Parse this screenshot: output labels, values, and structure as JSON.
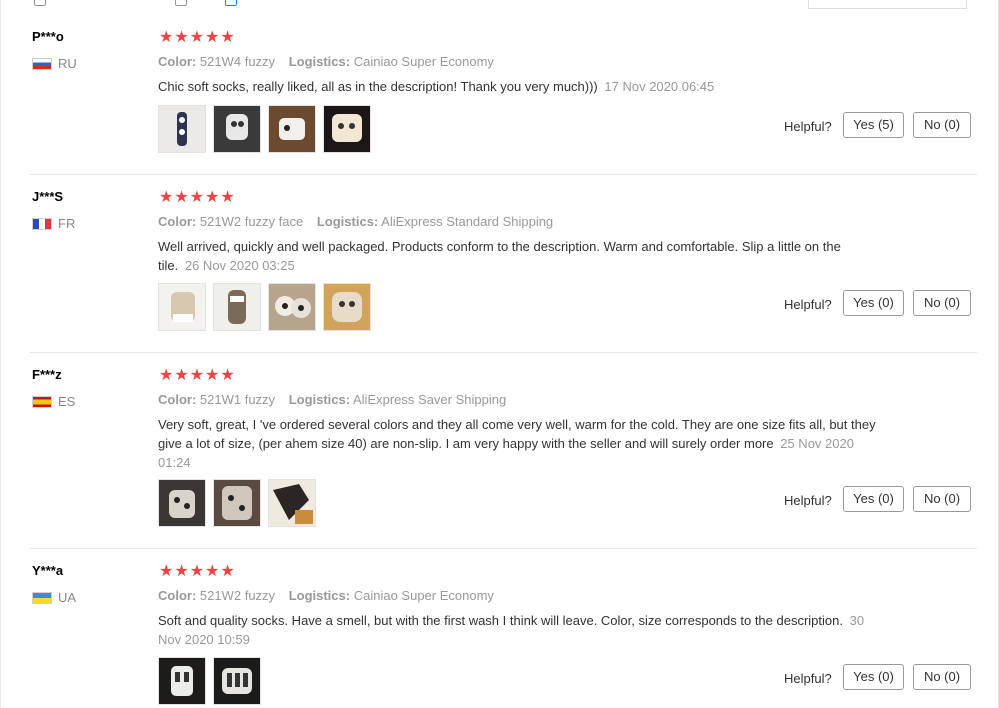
{
  "labels": {
    "color": "Color:",
    "logistics": "Logistics:",
    "helpful": "Helpful?"
  },
  "reviews": [
    {
      "user": "P***o",
      "country": "RU",
      "flag": "flag-ru",
      "stars": "★★★★★",
      "color": "521W4 fuzzy",
      "logistics": "Cainiao Super Economy",
      "text": "Chic soft socks, really liked, all as in the description! Thank you very much)))",
      "date": "17 Nov 2020 06:45",
      "yes": "Yes (5)",
      "no": "No (0)"
    },
    {
      "user": "J***S",
      "country": "FR",
      "flag": "flag-fr",
      "stars": "★★★★★",
      "color": "521W2 fuzzy face",
      "logistics": "AliExpress Standard Shipping",
      "text": "Well arrived, quickly and well packaged. Products conform to the description. Warm and comfortable. Slip a little on the tile.",
      "date": "26 Nov 2020 03:25",
      "yes": "Yes (0)",
      "no": "No (0)"
    },
    {
      "user": "F***z",
      "country": "ES",
      "flag": "flag-es",
      "stars": "★★★★★",
      "color": "521W1 fuzzy",
      "logistics": "AliExpress Saver Shipping",
      "text": "Very soft, great, I 've ordered several colors and they all come very well, warm for the cold. They are one size fits all, but they give a lot of size, (per ahem size 40) are non-slip. I am very happy with the seller and will surely order more",
      "date": "25 Nov 2020 01:24",
      "yes": "Yes (0)",
      "no": "No (0)"
    },
    {
      "user": "Y***a",
      "country": "UA",
      "flag": "flag-ua",
      "stars": "★★★★★",
      "color": "521W2 fuzzy",
      "logistics": "Cainiao Super Economy",
      "text": "Soft and quality socks. Have a smell, but with the first wash I think will leave. Color, size corresponds to the description.",
      "date": "30 Nov 2020 10:59",
      "yes": "Yes (0)",
      "no": "No (0)"
    }
  ]
}
